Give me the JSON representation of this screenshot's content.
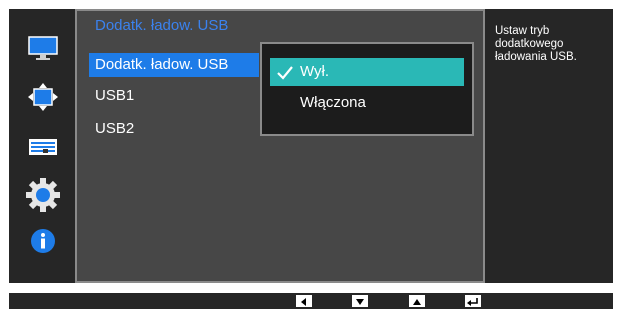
{
  "menu": {
    "title": "Dodatk. ładow. USB",
    "items": [
      {
        "label": "Dodatk. ładow. USB",
        "selected": true
      },
      {
        "label": "USB1",
        "selected": false
      },
      {
        "label": "USB2",
        "selected": false
      }
    ]
  },
  "dropdown": {
    "options": [
      {
        "label": "Wył.",
        "selected": true
      },
      {
        "label": "Włączona",
        "selected": false
      }
    ]
  },
  "help": {
    "text": "Ustaw tryb\ndodatkowego\nładowania USB."
  },
  "sidebar": {
    "icons": [
      "monitor-icon",
      "size-position-icon",
      "settings-panel-icon",
      "gear-icon",
      "info-icon"
    ],
    "accent": "#1e7ce8"
  },
  "bottom_bar": {
    "buttons": [
      "left-arrow-icon",
      "down-arrow-icon",
      "up-arrow-icon",
      "enter-icon"
    ]
  },
  "colors": {
    "selected_item": "#1e7ce8",
    "selected_option": "#2ab8b6",
    "title": "#3b82ee"
  }
}
